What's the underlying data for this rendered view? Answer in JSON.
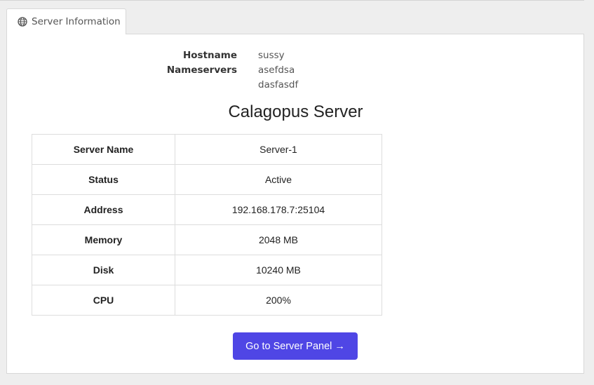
{
  "tab": {
    "label": "Server Information",
    "icon": "globe-icon"
  },
  "dns": {
    "hostname_label": "Hostname",
    "hostname_value": "sussy",
    "nameservers_label": "Nameservers",
    "nameservers": [
      "asefdsa",
      "dasfasdf"
    ]
  },
  "server": {
    "title": "Calagopus Server",
    "rows": [
      {
        "key": "Server Name",
        "value": "Server-1"
      },
      {
        "key": "Status",
        "value": "Active"
      },
      {
        "key": "Address",
        "value": "192.168.178.7:25104"
      },
      {
        "key": "Memory",
        "value": "2048 MB"
      },
      {
        "key": "Disk",
        "value": "10240 MB"
      },
      {
        "key": "CPU",
        "value": "200%"
      }
    ]
  },
  "action": {
    "button_label": "Go to Server Panel →",
    "button_color": "#4f46e5"
  }
}
